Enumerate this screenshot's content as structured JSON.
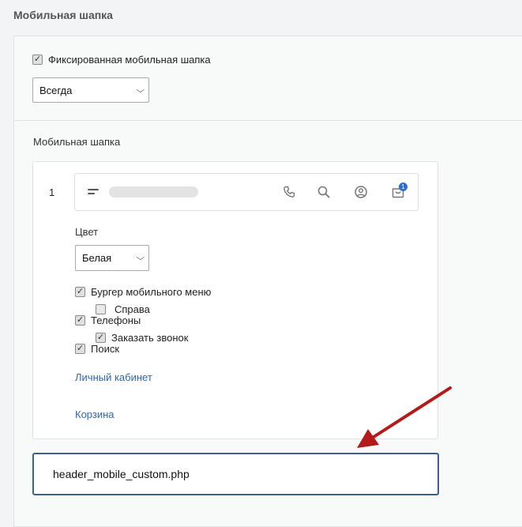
{
  "section": {
    "title": "Мобильная шапка"
  },
  "fixed_header": {
    "label": "Фиксированная мобильная шапка",
    "checked": true
  },
  "fixed_mode_select": {
    "value": "Всегда"
  },
  "mobile_header": {
    "label": "Мобильная шапка"
  },
  "layout_card": {
    "number": "1",
    "preview": {
      "icons": [
        "menu-icon",
        "phone-icon",
        "search-icon",
        "user-icon",
        "cart-icon"
      ],
      "cart_badge": "1"
    },
    "color": {
      "label": "Цвет",
      "value": "Белая"
    },
    "options": {
      "burger": {
        "label": "Бургер мобильного меню",
        "checked": true
      },
      "right": {
        "label": "Справа",
        "checked": false
      },
      "phones": {
        "label": "Телефоны",
        "checked": true
      },
      "callback": {
        "label": "Заказать звонок",
        "checked": true
      },
      "search": {
        "label": "Поиск",
        "checked": true
      }
    },
    "links": {
      "cabinet": "Личный кабинет",
      "cart": "Корзина"
    }
  },
  "custom_file": {
    "value": "header_mobile_custom.php"
  },
  "colors": {
    "link": "#2f67b0",
    "badge": "#2c6bd8",
    "arrow": "#b51a1a",
    "input_border": "#3e5f8a"
  }
}
